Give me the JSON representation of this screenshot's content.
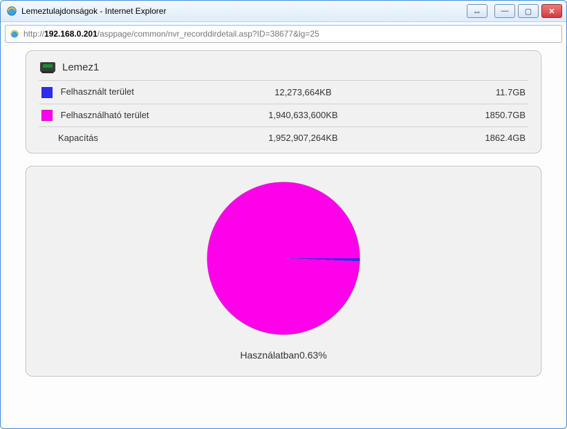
{
  "window": {
    "title": "Lemeztulajdonságok - Internet Explorer",
    "url_prefix": "http://",
    "url_host": "192.168.0.201",
    "url_path": "/asppage/common/nvr_recorddirdetail.asp?ID=38677&lg=25"
  },
  "disk": {
    "name": "Lemez1"
  },
  "rows": {
    "used": {
      "label": "Felhasznált terület",
      "kb": "12,273,664KB",
      "gb": "11.7GB",
      "color": "#2d2df0"
    },
    "available": {
      "label": "Felhasználható terület",
      "kb": "1,940,633,600KB",
      "gb": "1850.7GB",
      "color": "#ff00ea"
    },
    "capacity": {
      "label": "Kapacítás",
      "kb": "1,952,907,264KB",
      "gb": "1862.4GB"
    }
  },
  "chart_data": {
    "type": "pie",
    "title": "Használatban0.63%",
    "series": [
      {
        "name": "Felhasznált terület",
        "value": 12273664,
        "color": "#2d2df0"
      },
      {
        "name": "Felhasználható terület",
        "value": 1940633600,
        "color": "#ff00ea"
      }
    ],
    "usage_percent": 0.63
  },
  "usage_caption": "Használatban0.63%",
  "buttons": {
    "back": "⇔",
    "minimize": "—",
    "maximize": "▢",
    "close": "✕"
  }
}
